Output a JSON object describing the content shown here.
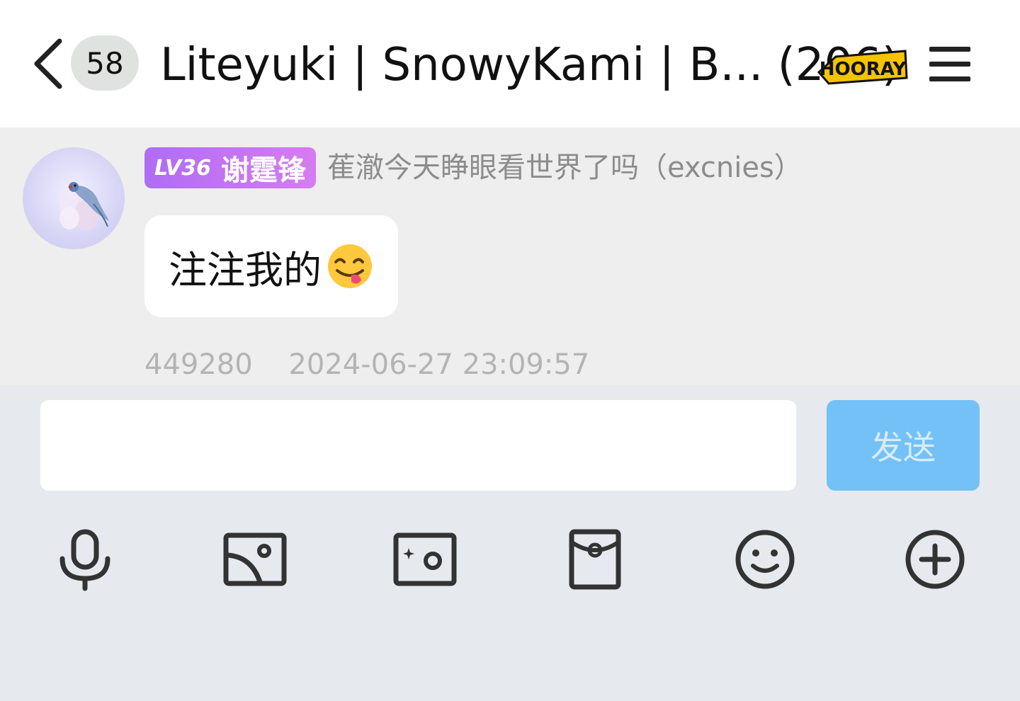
{
  "header": {
    "unread_count": "58",
    "title": "Liteyuki | SnowyKami | B... (206)",
    "sticker": "HOORAY"
  },
  "message": {
    "level": "LV36",
    "member_title": "谢霆锋",
    "sender": "萑澈今天睁眼看世界了吗（excnies）",
    "text": "注注我的",
    "emoji": "yum-face-emoji",
    "message_id": "449280",
    "timestamp": "2024-06-27 23:09:57"
  },
  "composer": {
    "value": "",
    "send_label": "发送"
  },
  "toolbar": {
    "icons": [
      "microphone-icon",
      "image-icon",
      "camera-icon",
      "red-packet-icon",
      "emoji-icon",
      "plus-icon"
    ]
  },
  "colors": {
    "level_tag": "#b06cf4",
    "send_button": "#74c1f7",
    "bubble": "#ffffff",
    "message_area": "#eeeeee",
    "input_area": "#e6eaee"
  }
}
